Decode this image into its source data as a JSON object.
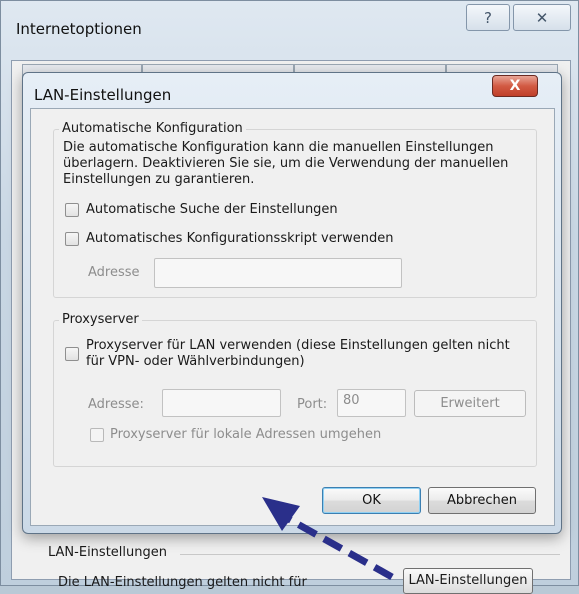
{
  "outer_window": {
    "title": "Internetoptionen",
    "help_icon": "help-icon",
    "close_icon": "close-icon",
    "group_label": "LAN-Einstellungen",
    "description": "Die LAN-Einstellungen gelten nicht für",
    "lan_button": "LAN-Einstellungen"
  },
  "dialog": {
    "title": "LAN-Einstellungen",
    "close_label": "X",
    "auto_config": {
      "legend": "Automatische Konfiguration",
      "description": "Die automatische Konfiguration kann die manuellen Einstellungen überlagern. Deaktivieren Sie sie, um die Verwendung der manuellen Einstellungen zu garantieren.",
      "auto_detect_label": "Automatische Suche der Einstellungen",
      "auto_detect_checked": false,
      "script_label": "Automatisches Konfigurationsskript verwenden",
      "script_checked": false,
      "address_label": "Adresse",
      "address_value": ""
    },
    "proxy": {
      "legend": "Proxyserver",
      "use_proxy_label": "Proxyserver für LAN verwenden (diese Einstellungen gelten nicht für VPN- oder Wählverbindungen)",
      "use_proxy_checked": false,
      "address_label": "Adresse:",
      "address_value": "",
      "port_label": "Port:",
      "port_value": "80",
      "advanced_button": "Erweitert",
      "bypass_label": "Proxyserver für lokale Adressen umgehen",
      "bypass_checked": false
    },
    "ok_button": "OK",
    "cancel_button": "Abbrechen"
  },
  "colors": {
    "annotation_arrow": "#2a2f8a"
  }
}
